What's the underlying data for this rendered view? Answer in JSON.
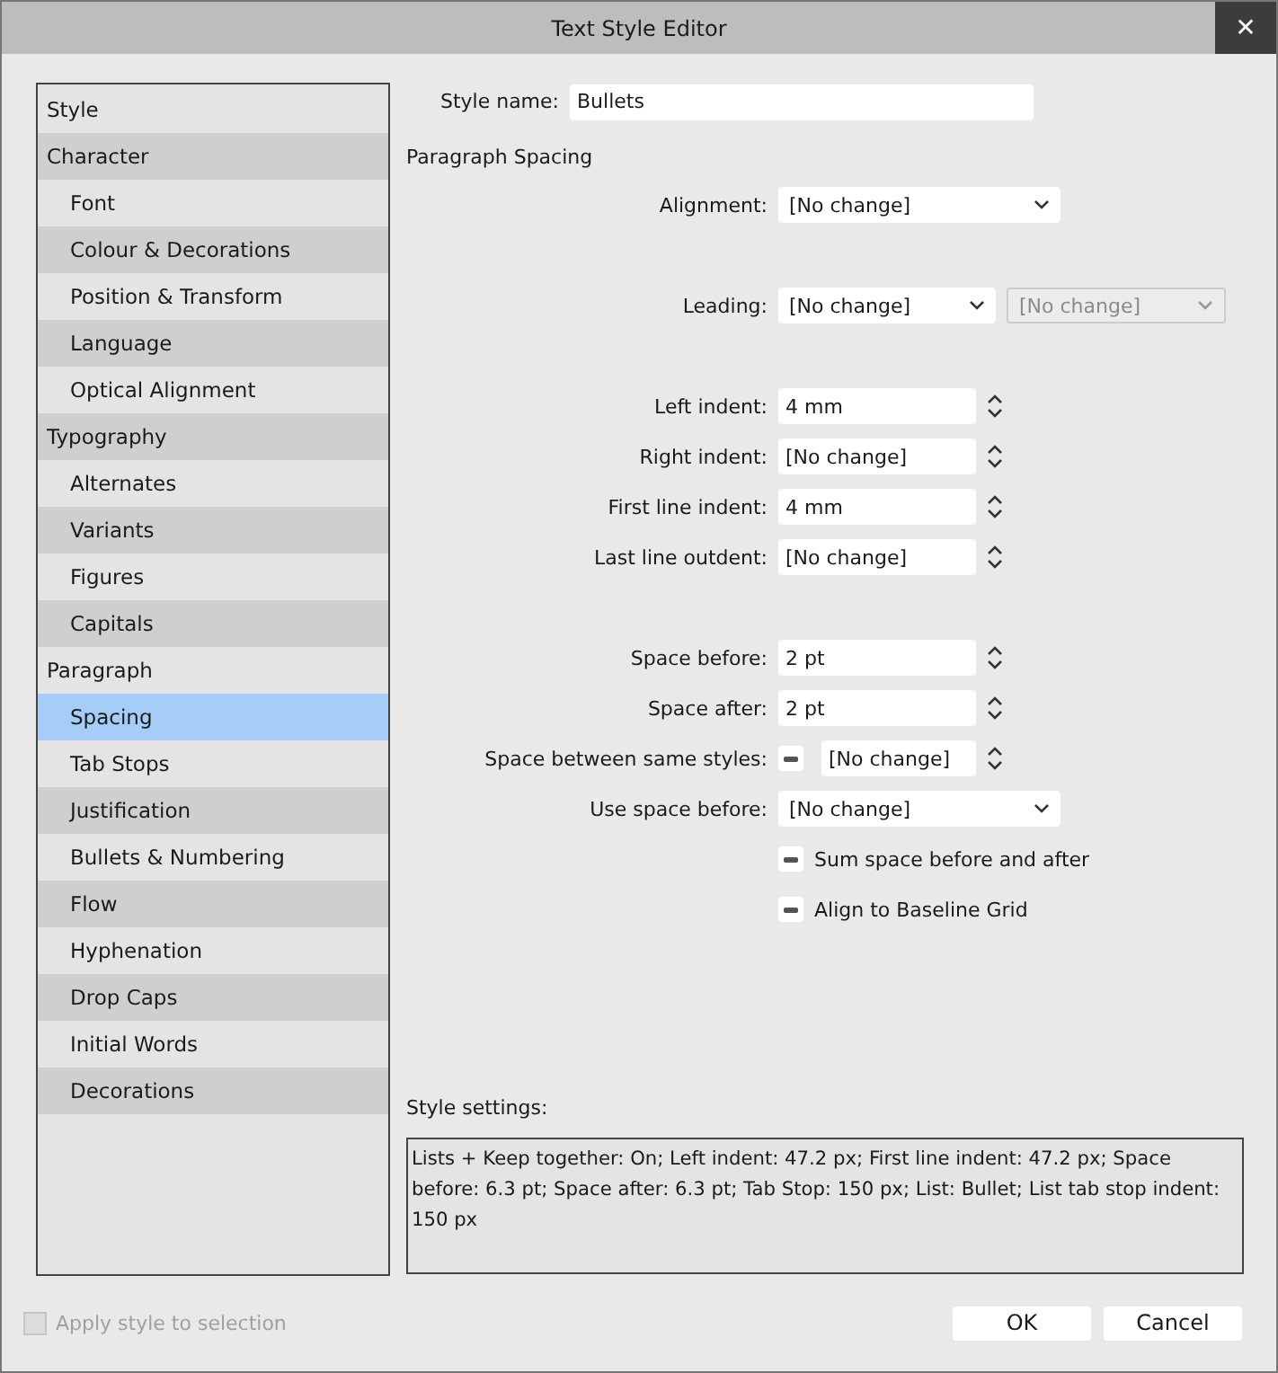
{
  "window": {
    "title": "Text Style Editor",
    "close": "✕"
  },
  "sidebar": {
    "items": [
      {
        "label": "Style",
        "selected": false
      },
      {
        "label": "Character",
        "selected": false,
        "children": [
          {
            "label": "Font",
            "selected": false
          },
          {
            "label": "Colour & Decorations",
            "selected": false
          },
          {
            "label": "Position & Transform",
            "selected": false
          },
          {
            "label": "Language",
            "selected": false
          },
          {
            "label": "Optical Alignment",
            "selected": false
          }
        ]
      },
      {
        "label": "Typography",
        "selected": false,
        "children": [
          {
            "label": "Alternates",
            "selected": false
          },
          {
            "label": "Variants",
            "selected": false
          },
          {
            "label": "Figures",
            "selected": false
          },
          {
            "label": "Capitals",
            "selected": false
          }
        ]
      },
      {
        "label": "Paragraph",
        "selected": false,
        "children": [
          {
            "label": "Spacing",
            "selected": true
          },
          {
            "label": "Tab Stops",
            "selected": false
          },
          {
            "label": "Justification",
            "selected": false
          },
          {
            "label": "Bullets & Numbering",
            "selected": false
          },
          {
            "label": "Flow",
            "selected": false
          },
          {
            "label": "Hyphenation",
            "selected": false
          },
          {
            "label": "Drop Caps",
            "selected": false
          },
          {
            "label": "Initial Words",
            "selected": false
          },
          {
            "label": "Decorations",
            "selected": false
          }
        ]
      }
    ]
  },
  "style_name": {
    "label": "Style name:",
    "value": "Bullets"
  },
  "section_title": "Paragraph Spacing",
  "sections": [
    {
      "rows": [
        {
          "kind": "dropdown",
          "label": "Alignment:",
          "value": "[No change]"
        }
      ]
    },
    {
      "rows": [
        {
          "kind": "dropdown-pair",
          "label": "Leading:",
          "value": "[No change]",
          "value_2": "[No change]",
          "disabled_2": true
        }
      ]
    },
    {
      "rows": [
        {
          "kind": "spinner",
          "label": "Left indent:",
          "value": "4 mm"
        },
        {
          "kind": "spinner",
          "label": "Right indent:",
          "value": "[No change]"
        },
        {
          "kind": "spinner",
          "label": "First line indent:",
          "value": "4 mm"
        },
        {
          "kind": "spinner",
          "label": "Last line outdent:",
          "value": "[No change]"
        }
      ]
    },
    {
      "rows": [
        {
          "kind": "spinner",
          "label": "Space before:",
          "value": "2 pt"
        },
        {
          "kind": "spinner",
          "label": "Space after:",
          "value": "2 pt"
        },
        {
          "kind": "check-spinner",
          "label": "Space between same styles:",
          "value": "[No change]",
          "indeterminate": true
        },
        {
          "kind": "dropdown",
          "label": "Use space before:",
          "value": "[No change]"
        },
        {
          "kind": "checkbox",
          "label": "Sum space before and after",
          "indeterminate": true
        },
        {
          "kind": "checkbox",
          "label": "Align to Baseline Grid",
          "indeterminate": true
        }
      ]
    }
  ],
  "style_settings": {
    "label": "Style settings:",
    "text": "Lists + Keep together: On; Left indent: 47.2 px; First line indent: 47.2 px; Space before: 6.3 pt; Space after: 6.3 pt; Tab Stop: 150 px; List: Bullet; List tab stop indent: 150 px"
  },
  "apply_to_selection": {
    "label": "Apply style to selection",
    "checked": false,
    "disabled": true
  },
  "buttons": [
    "OK",
    "Cancel"
  ]
}
